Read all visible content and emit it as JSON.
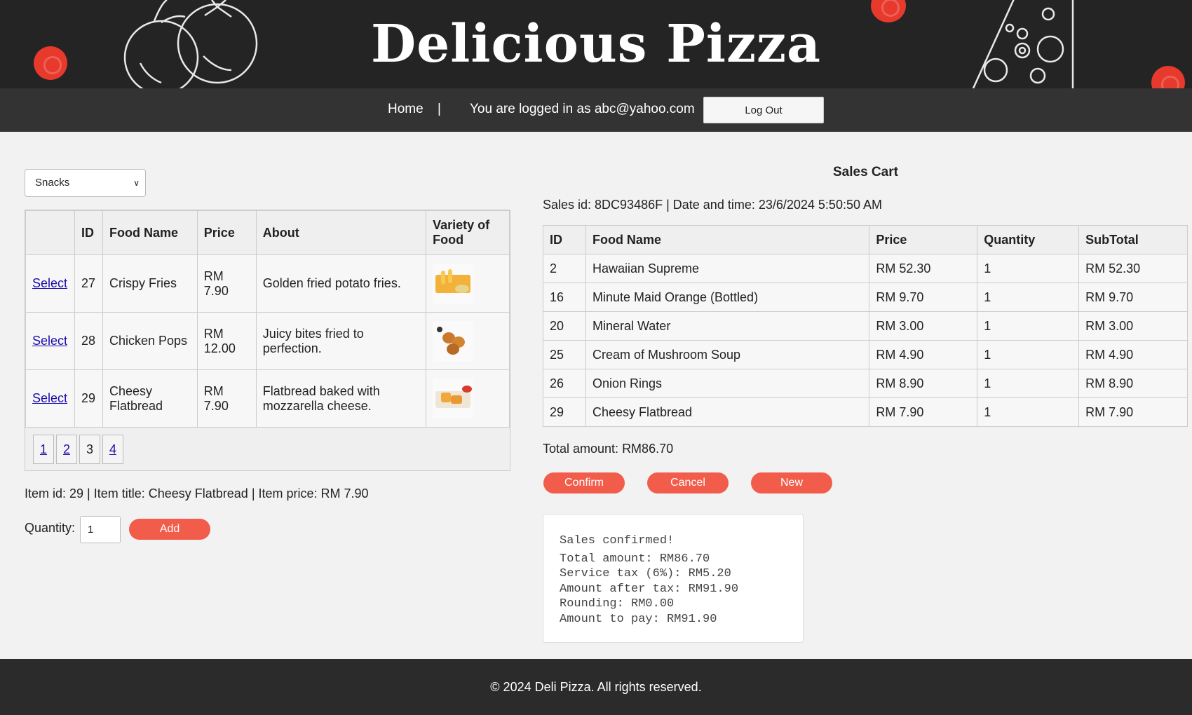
{
  "header": {
    "title": "Delicious Pizza"
  },
  "nav": {
    "home": "Home",
    "separator": "|",
    "user_text": "You are logged in as abc@yahoo.com",
    "logout": "Log Out"
  },
  "category": {
    "selected": "Snacks"
  },
  "menu": {
    "columns": [
      "",
      "ID",
      "Food Name",
      "Price",
      "About",
      "Variety of Food"
    ],
    "rows": [
      {
        "action": "Select",
        "id": "27",
        "name": "Crispy Fries",
        "price": "RM 7.90",
        "about": "Golden fried potato fries.",
        "image": "fries"
      },
      {
        "action": "Select",
        "id": "28",
        "name": "Chicken Pops",
        "price": "RM 12.00",
        "about": "Juicy bites fried to perfection.",
        "image": "chicken-pops"
      },
      {
        "action": "Select",
        "id": "29",
        "name": "Cheesy Flatbread",
        "price": "RM 7.90",
        "about": "Flatbread baked with mozzarella cheese.",
        "image": "flatbread"
      }
    ],
    "pages": [
      "1",
      "2",
      "3",
      "4"
    ],
    "current_page": "3"
  },
  "selection": {
    "info": "Item id: 29 | Item title: Cheesy Flatbread | Item price: RM 7.90",
    "quantity_label": "Quantity:",
    "quantity": "1",
    "add": "Add"
  },
  "cart": {
    "title": "Sales Cart",
    "sales_info": "Sales id: 8DC93486F | Date and time: 23/6/2024 5:50:50 AM",
    "columns": [
      "ID",
      "Food Name",
      "Price",
      "Quantity",
      "SubTotal"
    ],
    "rows": [
      {
        "id": "2",
        "name": "Hawaiian Supreme",
        "price": "RM 52.30",
        "qty": "1",
        "subtotal": "RM 52.30"
      },
      {
        "id": "16",
        "name": "Minute Maid Orange (Bottled)",
        "price": "RM 9.70",
        "qty": "1",
        "subtotal": "RM 9.70"
      },
      {
        "id": "20",
        "name": "Mineral Water",
        "price": "RM 3.00",
        "qty": "1",
        "subtotal": "RM 3.00"
      },
      {
        "id": "25",
        "name": "Cream of Mushroom Soup",
        "price": "RM 4.90",
        "qty": "1",
        "subtotal": "RM 4.90"
      },
      {
        "id": "26",
        "name": "Onion Rings",
        "price": "RM 8.90",
        "qty": "1",
        "subtotal": "RM 8.90"
      },
      {
        "id": "29",
        "name": "Cheesy Flatbread",
        "price": "RM 7.90",
        "qty": "1",
        "subtotal": "RM 7.90"
      }
    ],
    "total": "Total amount: RM86.70",
    "confirm": "Confirm",
    "cancel": "Cancel",
    "new": "New"
  },
  "receipt": {
    "lines": [
      "Sales confirmed!",
      "Total amount: RM86.70",
      "Service tax (6%): RM5.20",
      "Amount after tax: RM91.90",
      "Rounding: RM0.00",
      "Amount to pay: RM91.90"
    ]
  },
  "footer": {
    "text": "© 2024 Deli Pizza. All rights reserved."
  },
  "colors": {
    "accent": "#f25c4a",
    "header_bg": "#242424",
    "nav_bg": "#333333",
    "link": "#1a0dab"
  }
}
